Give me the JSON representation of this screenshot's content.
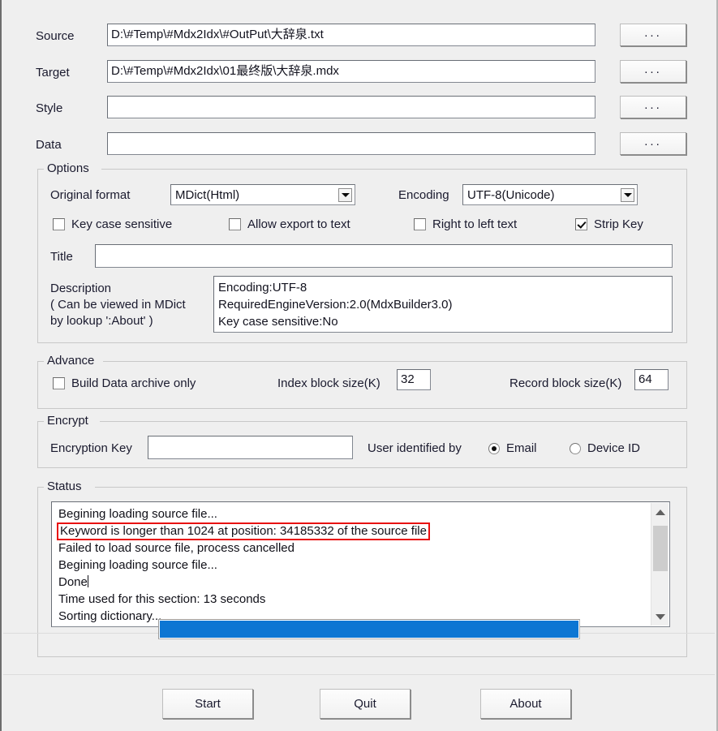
{
  "paths": {
    "rows": [
      {
        "label": "Source",
        "value": "D:\\#Temp\\#Mdx2Idx\\#OutPut\\大辞泉.txt",
        "browse_label": "..."
      },
      {
        "label": "Target",
        "value": "D:\\#Temp\\#Mdx2Idx\\01最终版\\大辞泉.mdx",
        "browse_label": "..."
      },
      {
        "label": "Style",
        "value": "",
        "browse_label": "..."
      },
      {
        "label": "Data",
        "value": "",
        "browse_label": "..."
      }
    ]
  },
  "options": {
    "group_title": "Options",
    "original_format_label": "Original format",
    "original_format_value": "MDict(Html)",
    "encoding_label": "Encoding",
    "encoding_value": "UTF-8(Unicode)",
    "checkboxes": [
      {
        "label": "Key case sensitive",
        "checked": false
      },
      {
        "label": "Allow export to text",
        "checked": false
      },
      {
        "label": "Right to left text",
        "checked": false
      },
      {
        "label": "Strip Key",
        "checked": true
      }
    ],
    "title_label": "Title",
    "title_value": "",
    "description_label_line1": "Description",
    "description_label_line2": "( Can be viewed in MDict",
    "description_label_line3": "by lookup ':About' )",
    "description_value": "Encoding:UTF-8\nRequiredEngineVersion:2.0(MdxBuilder3.0)\nKey case sensitive:No"
  },
  "advance": {
    "group_title": "Advance",
    "build_data_archive_only_label": "Build Data archive only",
    "build_data_archive_only_checked": false,
    "index_block_size_label": "Index block size(K)",
    "index_block_size_value": "32",
    "record_block_size_label": "Record block size(K)",
    "record_block_size_value": "64"
  },
  "encrypt": {
    "group_title": "Encrypt",
    "encryption_key_label": "Encryption Key",
    "encryption_key_value": "",
    "user_identified_by_label": "User identified by",
    "radios": [
      {
        "label": "Email",
        "selected": true
      },
      {
        "label": "Device ID",
        "selected": false
      }
    ]
  },
  "status": {
    "group_title": "Status",
    "lines": [
      {
        "text": "Begining loading source file...",
        "highlight": false
      },
      {
        "text": "Keyword is longer than 1024 at position: 34185332 of the source file",
        "highlight": true
      },
      {
        "text": "Failed to load source file, process cancelled",
        "highlight": false
      },
      {
        "text": "Begining loading source file...",
        "highlight": false
      },
      {
        "text": "Done",
        "highlight": false,
        "caret": true
      },
      {
        "text": "Time used for this section: 13 seconds",
        "highlight": false
      },
      {
        "text": "Sorting dictionary...",
        "highlight": false
      }
    ],
    "scroll_up_icon": "chevron-up-icon",
    "scroll_down_icon": "chevron-down-icon"
  },
  "progress": {
    "percent": 100
  },
  "buttons": {
    "start": "Start",
    "quit": "Quit",
    "about": "About"
  },
  "colors": {
    "highlight_border": "#e81010",
    "progress_fill": "#0d76d3",
    "window_bg": "#efefef"
  }
}
